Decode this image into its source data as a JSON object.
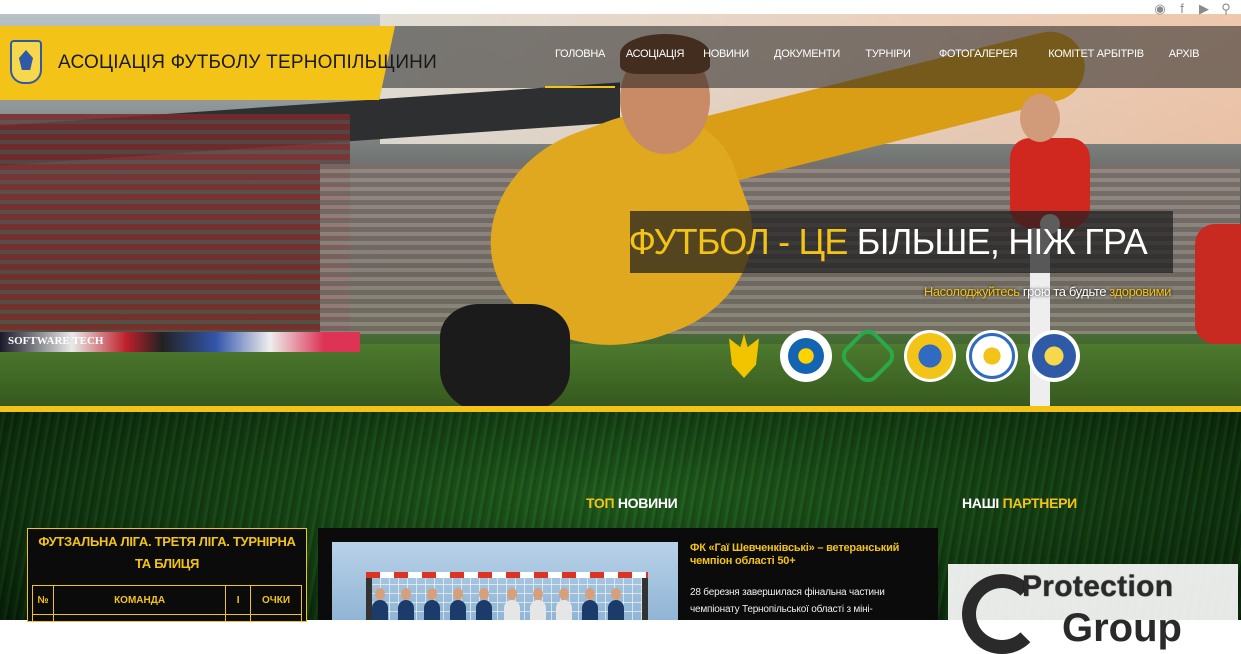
{
  "site": {
    "title": "АСОЦІАЦІЯ ФУТБОЛУ ТЕРНОПІЛЬЩИНИ",
    "accent_color": "#f3c417"
  },
  "social": [
    {
      "name": "telegram-icon",
      "glyph": "◉"
    },
    {
      "name": "facebook-icon",
      "glyph": "f"
    },
    {
      "name": "youtube-icon",
      "glyph": "▶"
    },
    {
      "name": "search-icon",
      "glyph": "⚲"
    }
  ],
  "nav": [
    {
      "label": "ГОЛОВНА",
      "active": true
    },
    {
      "label": "АСОЦІАЦІЯ"
    },
    {
      "label": "НОВИНИ"
    },
    {
      "label": "ДОКУМЕНТИ"
    },
    {
      "label": "ТУРНІРИ"
    },
    {
      "label": "ФОТОГАЛЕРЕЯ"
    },
    {
      "label": "КОМІТЕТ АРБІТРІВ"
    },
    {
      "label": "АРХІВ"
    }
  ],
  "hero": {
    "slogan_part1": "ФУТБОЛ - ЦЕ ",
    "slogan_part2": "БІЛЬШЕ, НІЖ ГРА",
    "sub_y1": "Насолоджуйтесь",
    "sub_w1": " грою та будьте ",
    "sub_y2": "здоровими",
    "ad_text": "SOFTWARE  TECH"
  },
  "sections": {
    "top_news_y": "ТОП",
    "top_news_w": " НОВИНИ",
    "partners_w": "НАШІ ",
    "partners_y": "ПАРТНЕРИ"
  },
  "table": {
    "title": "ФУТЗАЛЬНА ЛІГА. ТРЕТЯ ЛІГА. ТУРНІРНА ТА БЛИЦЯ",
    "headers": [
      "№",
      "КОМАНДА",
      "І",
      "ОЧКИ"
    ]
  },
  "news": {
    "title": "ФК «Гаї Шевченківські» – ветеранський чемпіон області 50+",
    "text": "28 березня завершилася фінальна частини чемпіонату Тернопільської області з міні-"
  },
  "partner": {
    "name": "Protection",
    "name2": "Group"
  }
}
